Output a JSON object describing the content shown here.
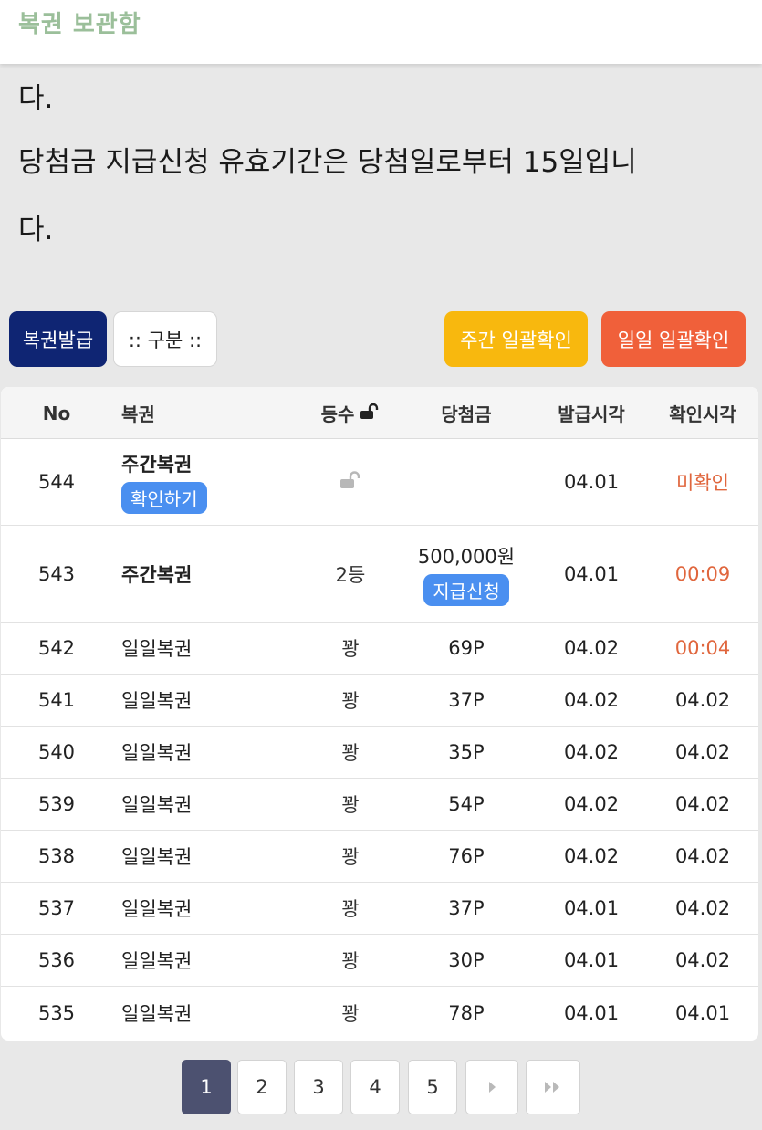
{
  "header": {
    "title": "복권 보관함"
  },
  "notice": {
    "line1": "다.",
    "line2": "당첨금 지급신청 유효기간은 당첨일로부터 15일입니",
    "line3": "다."
  },
  "toolbar": {
    "issue_label": "복권발급",
    "filter_label": ":: 구분 ::",
    "weekly_confirm_label": "주간 일괄확인",
    "daily_confirm_label": "일일 일괄확인"
  },
  "table": {
    "headers": {
      "no": "No",
      "name": "복권",
      "rank": "등수",
      "prize": "당첨금",
      "issued": "발급시각",
      "checked": "확인시각"
    },
    "rows": [
      {
        "no": "544",
        "name": "주간복권",
        "action": "확인하기",
        "rank": "",
        "rank_icon": "unlock-icon",
        "prize": "",
        "issued": "04.01",
        "checked": "미확인",
        "checked_color": "#e0663d"
      },
      {
        "no": "543",
        "name": "주간복권",
        "rank": "2등",
        "prize": "500,000원",
        "prize_action": "지급신청",
        "issued": "04.01",
        "checked": "00:09",
        "checked_color": "#e0663d"
      },
      {
        "no": "542",
        "name": "일일복권",
        "rank": "꽝",
        "prize": "69P",
        "issued": "04.02",
        "checked": "00:04",
        "checked_color": "#e0663d"
      },
      {
        "no": "541",
        "name": "일일복권",
        "rank": "꽝",
        "prize": "37P",
        "issued": "04.02",
        "checked": "04.02"
      },
      {
        "no": "540",
        "name": "일일복권",
        "rank": "꽝",
        "prize": "35P",
        "issued": "04.02",
        "checked": "04.02"
      },
      {
        "no": "539",
        "name": "일일복권",
        "rank": "꽝",
        "prize": "54P",
        "issued": "04.02",
        "checked": "04.02"
      },
      {
        "no": "538",
        "name": "일일복권",
        "rank": "꽝",
        "prize": "76P",
        "issued": "04.02",
        "checked": "04.02"
      },
      {
        "no": "537",
        "name": "일일복권",
        "rank": "꽝",
        "prize": "37P",
        "issued": "04.01",
        "checked": "04.02"
      },
      {
        "no": "536",
        "name": "일일복권",
        "rank": "꽝",
        "prize": "30P",
        "issued": "04.01",
        "checked": "04.02"
      },
      {
        "no": "535",
        "name": "일일복권",
        "rank": "꽝",
        "prize": "78P",
        "issued": "04.01",
        "checked": "04.01"
      }
    ]
  },
  "pagination": {
    "pages": [
      "1",
      "2",
      "3",
      "4",
      "5"
    ],
    "current": "1",
    "next_icon": "next-icon",
    "last_icon": "last-icon"
  }
}
